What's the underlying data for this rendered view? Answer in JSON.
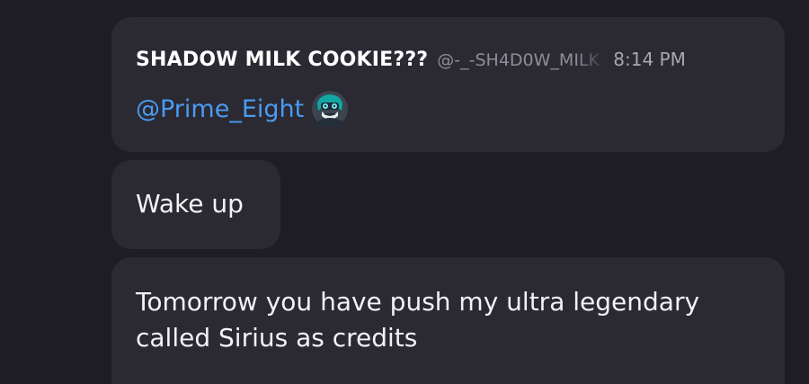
{
  "messages": [
    {
      "author": "SHADOW MILK COOKIE???",
      "handle": "@-_-SH4D0W_MILK",
      "time": "8:14 PM",
      "mention": "@Prime_Eight",
      "avatar_icon": "robot-avatar-icon"
    },
    {
      "text": "Wake up"
    },
    {
      "text": "Tomorrow you have push my ultra legendary called Sirius as credits"
    }
  ],
  "colors": {
    "background": "#1e1c24",
    "bubble": "#2b2932",
    "mention": "#4a9bf2",
    "muted": "#8e8c96"
  }
}
